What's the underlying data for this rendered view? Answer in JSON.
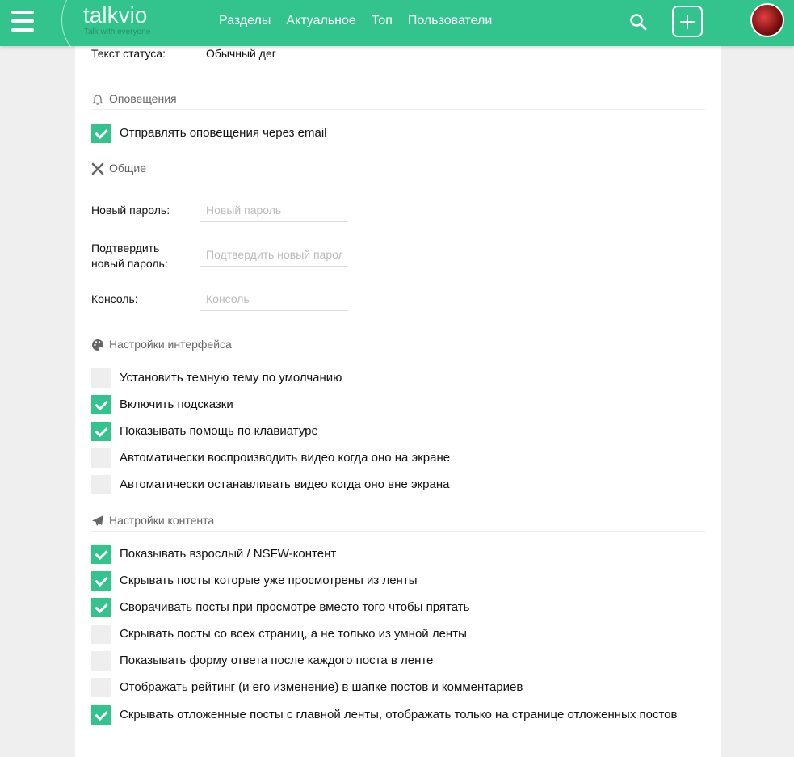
{
  "header": {
    "logo": "talkvio",
    "tagline": "Talk with everyone",
    "nav": [
      "Разделы",
      "Актуальное",
      "Топ",
      "Пользователи"
    ],
    "accent": "#33c48e"
  },
  "status": {
    "label": "Текст статуса:",
    "value": "Обычный дег"
  },
  "notifications": {
    "title": "Оповещения",
    "icon": "bell-icon",
    "items": [
      {
        "label": "Отправлять оповещения через email",
        "checked": true
      }
    ]
  },
  "general": {
    "title": "Общие",
    "icon": "tools-icon",
    "fields": [
      {
        "label": "Новый пароль:",
        "placeholder": "Новый пароль"
      },
      {
        "label": "Подтвердить новый пароль:",
        "placeholder": "Подтвердить новый пароль"
      },
      {
        "label": "Консоль:",
        "placeholder": "Консоль"
      }
    ]
  },
  "interface": {
    "title": "Настройки интерфейса",
    "icon": "palette-icon",
    "items": [
      {
        "label": "Установить темную тему по умолчанию",
        "checked": false
      },
      {
        "label": "Включить подсказки",
        "checked": true
      },
      {
        "label": "Показывать помощь по клавиатуре",
        "checked": true
      },
      {
        "label": "Автоматически воспроизводить видео когда оно на экране",
        "checked": false
      },
      {
        "label": "Автоматически останавливать видео когда оно вне экрана",
        "checked": false
      }
    ]
  },
  "content": {
    "title": "Настройки контента",
    "icon": "paper-plane-icon",
    "items": [
      {
        "label": "Показывать взрослый / NSFW-контент",
        "checked": true
      },
      {
        "label": "Скрывать посты которые уже просмотрены из ленты",
        "checked": true
      },
      {
        "label": "Сворачивать посты при просмотре вместо того чтобы прятать",
        "checked": true
      },
      {
        "label": "Скрывать посты со всех страниц, а не только из умной ленты",
        "checked": false
      },
      {
        "label": "Показывать форму ответа после каждого поста в ленте",
        "checked": false
      },
      {
        "label": "Отображать рейтинг (и его изменение) в шапке постов и комментариев",
        "checked": false
      },
      {
        "label": "Скрывать отложенные посты с главной ленты, отображать только на странице отложенных постов",
        "checked": true
      }
    ]
  }
}
